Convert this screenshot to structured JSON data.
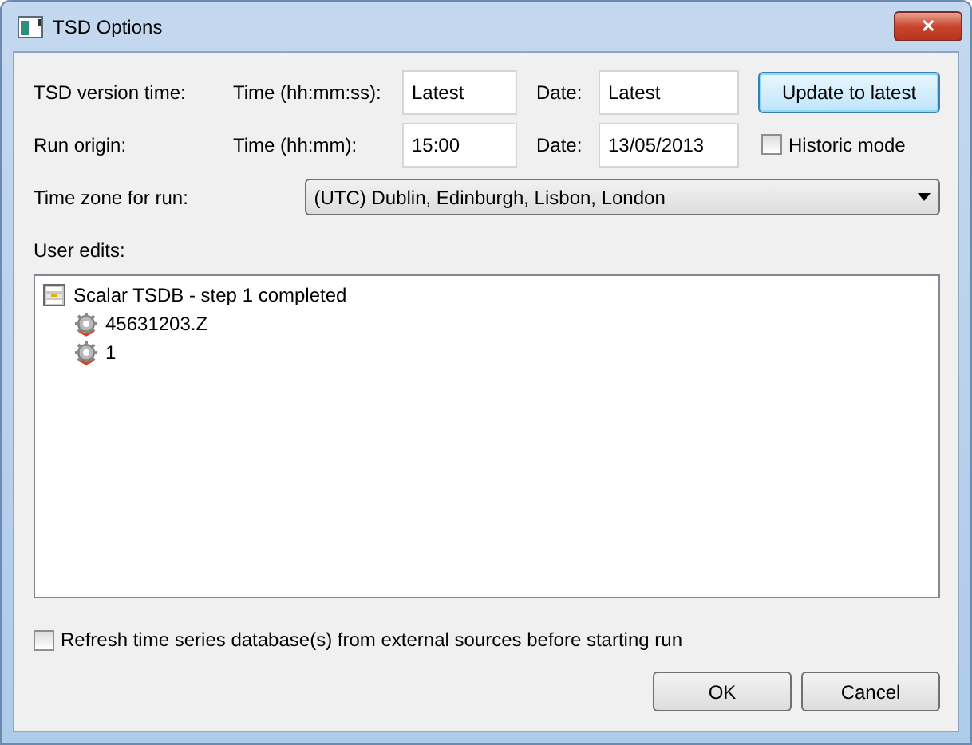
{
  "window": {
    "title": "TSD Options",
    "close": "✕"
  },
  "version_time": {
    "label": "TSD version time:",
    "time_label": "Time (hh:mm:ss):",
    "time_value": "Latest",
    "date_label": "Date:",
    "date_value": "Latest",
    "button": "Update to latest"
  },
  "run_origin": {
    "label": "Run origin:",
    "time_label": "Time (hh:mm):",
    "time_value": "15:00",
    "date_label": "Date:",
    "date_value": "13/05/2013",
    "historic": {
      "label": "Historic mode",
      "checked": false
    }
  },
  "time_zone": {
    "label": "Time zone for run:",
    "value": "(UTC) Dublin, Edinburgh, Lisbon, London"
  },
  "user_edits": {
    "label": "User edits:",
    "tree": [
      {
        "kind": "database",
        "label": "Scalar TSDB - step 1 completed",
        "children": [
          {
            "kind": "gear",
            "label": "45631203.Z"
          },
          {
            "kind": "gear",
            "label": "1"
          }
        ]
      }
    ]
  },
  "refresh": {
    "label": "Refresh time series database(s) from external sources before starting run",
    "checked": false
  },
  "buttons": [
    "OK",
    "Cancel"
  ]
}
